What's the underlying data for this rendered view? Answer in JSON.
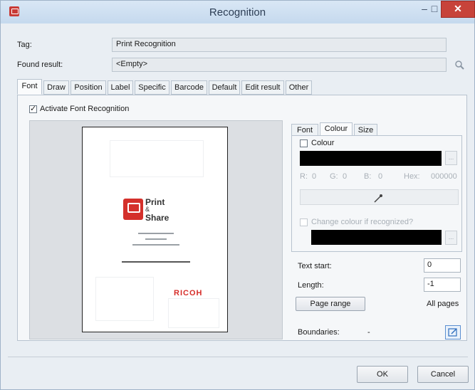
{
  "window": {
    "title": "Recognition",
    "minimize_glyph": "–",
    "maximize_glyph": "□",
    "close_glyph": "✕"
  },
  "fields": {
    "tag_label": "Tag:",
    "tag_value": "Print Recognition",
    "found_label": "Found result:",
    "found_value": "<Empty>"
  },
  "tabs": [
    "Font",
    "Draw",
    "Position",
    "Label",
    "Specific",
    "Barcode",
    "Default",
    "Edit result",
    "Other"
  ],
  "active_tab": "Font",
  "activate_label": "Activate Font Recognition",
  "preview": {
    "logo_line1": "Print",
    "logo_line2": "&",
    "logo_line3": "Share",
    "brand": "RICOH"
  },
  "right_tabs": [
    "Font",
    "Colour",
    "Size"
  ],
  "right_active_tab": "Colour",
  "colour": {
    "checkbox_label": "Colour",
    "dots": "...",
    "r_label": "R:",
    "r_value": "0",
    "g_label": "G:",
    "g_value": "0",
    "b_label": "B:",
    "b_value": "0",
    "hex_label": "Hex:",
    "hex_value": "000000",
    "change_label": "Change colour if recognized?"
  },
  "text_start_label": "Text start:",
  "text_start_value": "0",
  "length_label": "Length:",
  "length_value": "-1",
  "page_range_label": "Page range",
  "all_pages_label": "All pages",
  "boundaries_label": "Boundaries:",
  "boundaries_value": "-",
  "ok_label": "OK",
  "cancel_label": "Cancel",
  "colors": {
    "accent": "#c7433a",
    "brand_red": "#d62e2a"
  }
}
